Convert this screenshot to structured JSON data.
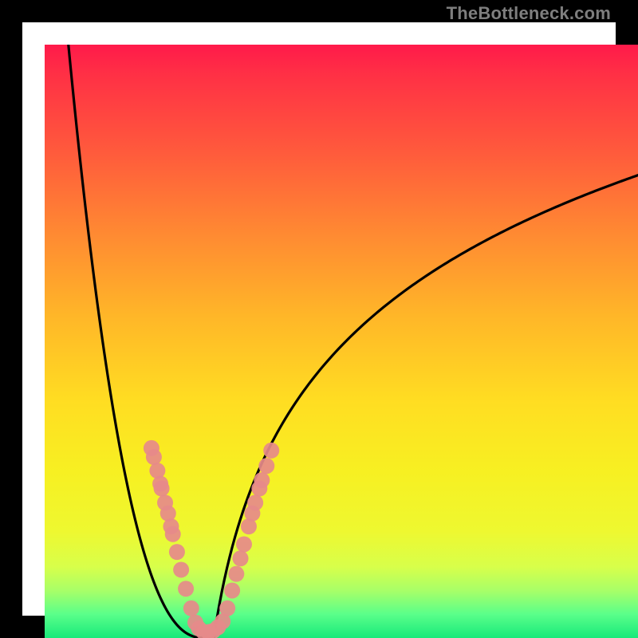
{
  "watermark": "TheBottleneck.com",
  "chart_data": {
    "type": "line",
    "title": "",
    "xlabel": "",
    "ylabel": "",
    "xlim": [
      0,
      100
    ],
    "ylim": [
      0,
      100
    ],
    "curve": {
      "left_top": {
        "x": 4,
        "y": 100
      },
      "valley_min": {
        "x": 27,
        "y": 0
      },
      "right_end": {
        "x": 100,
        "y": 78
      }
    },
    "gradient_stops": [
      {
        "pos": 0,
        "color": "#ff1a4a"
      },
      {
        "pos": 50,
        "color": "#ffcc22"
      },
      {
        "pos": 92,
        "color": "#d8ff4a"
      },
      {
        "pos": 100,
        "color": "#18e97a"
      }
    ],
    "marker_clusters": [
      {
        "side": "left",
        "points": [
          {
            "x": 18.0,
            "y": 32.0
          },
          {
            "x": 18.4,
            "y": 30.5
          },
          {
            "x": 19.0,
            "y": 28.2
          },
          {
            "x": 19.5,
            "y": 26.0
          },
          {
            "x": 19.7,
            "y": 25.2
          },
          {
            "x": 20.3,
            "y": 22.8
          },
          {
            "x": 20.8,
            "y": 21.0
          },
          {
            "x": 21.3,
            "y": 18.8
          },
          {
            "x": 21.6,
            "y": 17.5
          },
          {
            "x": 22.3,
            "y": 14.5
          },
          {
            "x": 23.0,
            "y": 11.5
          },
          {
            "x": 23.8,
            "y": 8.3
          },
          {
            "x": 24.7,
            "y": 5.0
          }
        ]
      },
      {
        "side": "valley",
        "points": [
          {
            "x": 25.4,
            "y": 2.6
          },
          {
            "x": 26.0,
            "y": 1.6
          },
          {
            "x": 26.8,
            "y": 1.0
          },
          {
            "x": 27.6,
            "y": 1.0
          },
          {
            "x": 28.4,
            "y": 1.2
          },
          {
            "x": 29.2,
            "y": 1.8
          },
          {
            "x": 30.0,
            "y": 2.8
          }
        ]
      },
      {
        "side": "right",
        "points": [
          {
            "x": 30.8,
            "y": 5.0
          },
          {
            "x": 31.6,
            "y": 8.0
          },
          {
            "x": 32.3,
            "y": 10.8
          },
          {
            "x": 33.0,
            "y": 13.4
          },
          {
            "x": 33.6,
            "y": 15.8
          },
          {
            "x": 34.4,
            "y": 18.8
          },
          {
            "x": 35.0,
            "y": 21.0
          },
          {
            "x": 35.5,
            "y": 22.8
          },
          {
            "x": 36.2,
            "y": 25.2
          },
          {
            "x": 36.6,
            "y": 26.6
          },
          {
            "x": 37.4,
            "y": 29.0
          },
          {
            "x": 38.2,
            "y": 31.6
          }
        ]
      }
    ],
    "marker_color": "#e68a8a",
    "marker_radius_px": 10
  }
}
